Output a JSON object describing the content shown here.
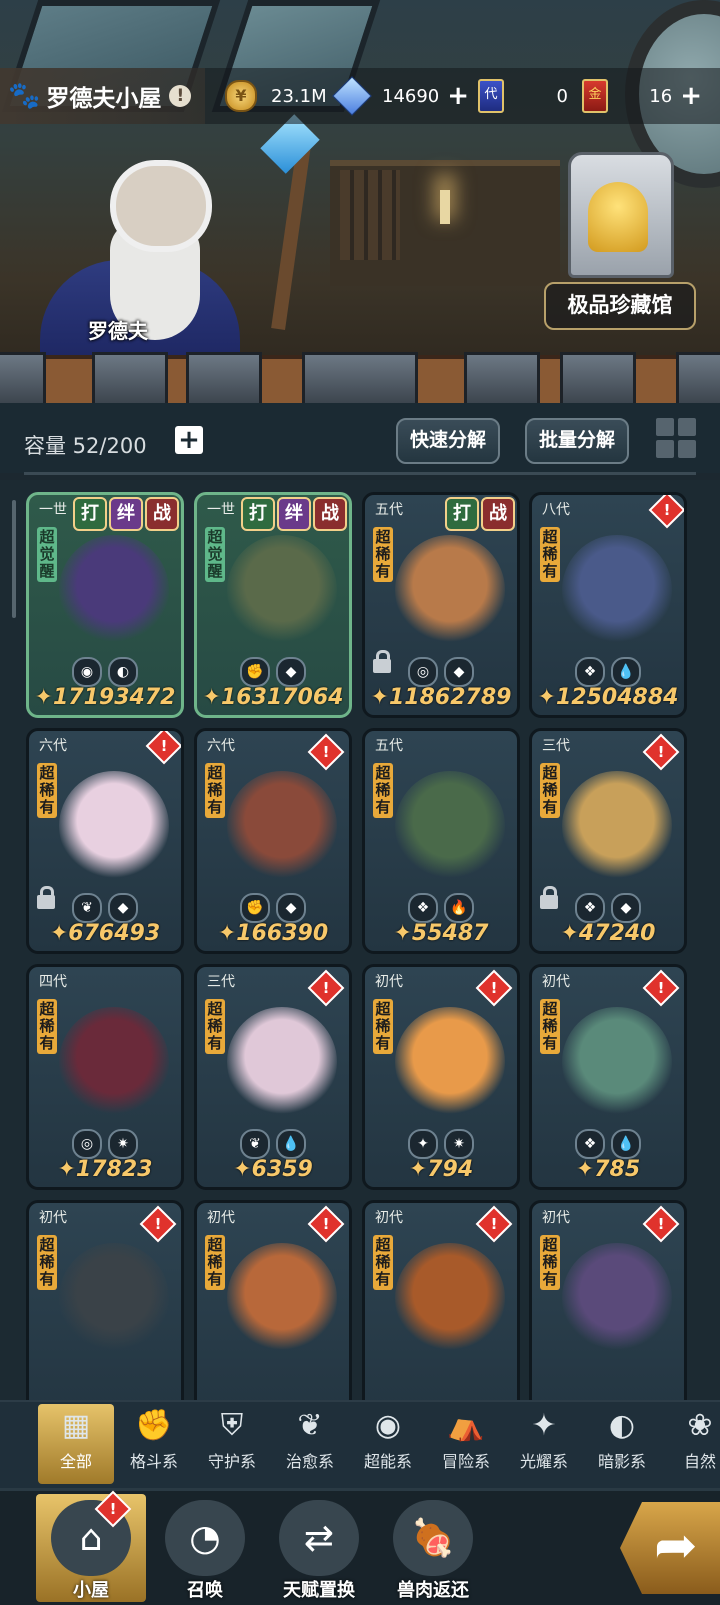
{
  "header": {
    "title": "罗德夫小屋",
    "info_badge": "!",
    "coins": "23.1M",
    "crystals": "14690",
    "cards_blue": "0",
    "cards_gold": "16",
    "card_blue_glyph": "代",
    "card_gold_glyph": "金",
    "plus": "+"
  },
  "scene": {
    "npc_name": "罗德夫",
    "museum_label": "极品珍藏馆"
  },
  "storage": {
    "capacity_label": "容量 52/200",
    "plus": "+",
    "quick_decompose": "快速分解",
    "batch_decompose": "批量分解"
  },
  "pets": [
    {
      "gen": "一世",
      "rarity": "超觉醒",
      "power": "17193472",
      "badges": [
        "打",
        "绊",
        "战"
      ],
      "types": [
        "◉",
        "◐"
      ],
      "awakened": true,
      "alert": false,
      "locked": false,
      "color": "#4a3a7a"
    },
    {
      "gen": "一世",
      "rarity": "超觉醒",
      "power": "16317064",
      "badges": [
        "打",
        "绊",
        "战"
      ],
      "types": [
        "✊",
        "◆"
      ],
      "awakened": true,
      "alert": false,
      "locked": false,
      "color": "#5a6a4a"
    },
    {
      "gen": "五代",
      "rarity": "超稀有",
      "power": "11862789",
      "badges": [
        "打",
        "战"
      ],
      "types": [
        "◎",
        "◆"
      ],
      "awakened": false,
      "alert": false,
      "locked": true,
      "color": "#b87a4a"
    },
    {
      "gen": "八代",
      "rarity": "超稀有",
      "power": "12504884",
      "badges": [],
      "types": [
        "❖",
        "💧"
      ],
      "awakened": false,
      "alert": true,
      "alert_boxed": true,
      "locked": false,
      "color": "#4a5a8a"
    },
    {
      "gen": "六代",
      "rarity": "超稀有",
      "power": "676493",
      "badges": [],
      "types": [
        "❦",
        "◆"
      ],
      "awakened": false,
      "alert": true,
      "alert_boxed": true,
      "locked": true,
      "color": "#e8d0e0"
    },
    {
      "gen": "六代",
      "rarity": "超稀有",
      "power": "166390",
      "badges": [],
      "types": [
        "✊",
        "◆"
      ],
      "awakened": false,
      "alert": true,
      "locked": false,
      "color": "#8a4a3a"
    },
    {
      "gen": "五代",
      "rarity": "超稀有",
      "power": "55487",
      "badges": [],
      "types": [
        "❖",
        "🔥"
      ],
      "awakened": false,
      "alert": false,
      "locked": false,
      "color": "#4a6a4a"
    },
    {
      "gen": "三代",
      "rarity": "超稀有",
      "power": "47240",
      "badges": [],
      "types": [
        "❖",
        "◆"
      ],
      "awakened": false,
      "alert": true,
      "locked": true,
      "color": "#c8a05a"
    },
    {
      "gen": "四代",
      "rarity": "超稀有",
      "power": "17823",
      "badges": [],
      "types": [
        "◎",
        "✷"
      ],
      "awakened": false,
      "alert": false,
      "locked": false,
      "color": "#6a2a3a"
    },
    {
      "gen": "三代",
      "rarity": "超稀有",
      "power": "6359",
      "badges": [],
      "types": [
        "❦",
        "💧"
      ],
      "awakened": false,
      "alert": true,
      "locked": false,
      "color": "#e0c8d8"
    },
    {
      "gen": "初代",
      "rarity": "超稀有",
      "power": "794",
      "badges": [],
      "types": [
        "✦",
        "✷"
      ],
      "awakened": false,
      "alert": true,
      "locked": false,
      "color": "#e89a4a"
    },
    {
      "gen": "初代",
      "rarity": "超稀有",
      "power": "785",
      "badges": [],
      "types": [
        "❖",
        "💧"
      ],
      "awakened": false,
      "alert": true,
      "locked": false,
      "color": "#5a8a7a"
    },
    {
      "gen": "初代",
      "rarity": "超稀有",
      "power": "",
      "badges": [],
      "types": [],
      "awakened": false,
      "alert": true,
      "locked": false,
      "color": "#3a4248"
    },
    {
      "gen": "初代",
      "rarity": "超稀有",
      "power": "",
      "badges": [],
      "types": [],
      "awakened": false,
      "alert": true,
      "locked": false,
      "color": "#b8683a"
    },
    {
      "gen": "初代",
      "rarity": "超稀有",
      "power": "",
      "badges": [],
      "types": [],
      "awakened": false,
      "alert": true,
      "locked": false,
      "color": "#a85a2a"
    },
    {
      "gen": "初代",
      "rarity": "超稀有",
      "power": "",
      "badges": [],
      "types": [],
      "awakened": false,
      "alert": true,
      "locked": false,
      "color": "#5a4a7a"
    }
  ],
  "alert_glyph": "!",
  "categories": [
    {
      "label": "全部",
      "icon": "▦"
    },
    {
      "label": "格斗系",
      "icon": "✊"
    },
    {
      "label": "守护系",
      "icon": "⛨"
    },
    {
      "label": "治愈系",
      "icon": "❦"
    },
    {
      "label": "超能系",
      "icon": "◉"
    },
    {
      "label": "冒险系",
      "icon": "⛺"
    },
    {
      "label": "光耀系",
      "icon": "✦"
    },
    {
      "label": "暗影系",
      "icon": "◐"
    },
    {
      "label": "自然",
      "icon": "❀"
    }
  ],
  "nav": [
    {
      "label": "小屋",
      "icon": "⌂"
    },
    {
      "label": "召唤",
      "icon": "◔"
    },
    {
      "label": "天赋置换",
      "icon": "⇄"
    },
    {
      "label": "兽肉返还",
      "icon": "🍖"
    }
  ],
  "colors": {
    "accent": "#e6c36a",
    "power": "#f7c86a",
    "alert": "#e0322c"
  }
}
